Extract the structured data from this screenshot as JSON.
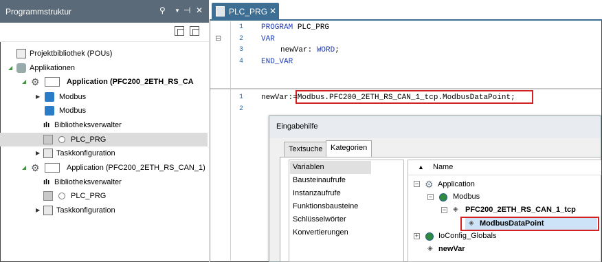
{
  "left_panel": {
    "title": "Programmstruktur",
    "header_icons": [
      "person-search-icon",
      "dropdown-icon",
      "pin-icon",
      "close-icon"
    ],
    "tree": [
      {
        "label": "Projektbibliothek (POUs)",
        "icon": "library-icon"
      },
      {
        "label": "Applikationen",
        "icon": "applications-icon"
      },
      {
        "label": "Application (PFC200_2ETH_RS_CA",
        "icon": "gear-icon",
        "bold": true
      },
      {
        "label": "Modbus",
        "icon": "folder-icon"
      },
      {
        "label": "Modbus",
        "icon": "folder-icon"
      },
      {
        "label": "Bibliotheksverwalter",
        "icon": "library-manager-icon"
      },
      {
        "label": "PLC_PRG",
        "icon": "program-icon",
        "selected": true
      },
      {
        "label": "Taskkonfiguration",
        "icon": "task-config-icon"
      },
      {
        "label": "Application (PFC200_2ETH_RS_CAN_1)",
        "icon": "gear-icon"
      },
      {
        "label": "Bibliotheksverwalter",
        "icon": "library-manager-icon"
      },
      {
        "label": "PLC_PRG",
        "icon": "program-icon"
      },
      {
        "label": "Taskkonfiguration",
        "icon": "task-config-icon"
      }
    ]
  },
  "editor": {
    "tab_label": "PLC_PRG",
    "tab_close": "✕",
    "declaration": {
      "line_numbers": [
        "1",
        "2",
        "3",
        "4"
      ],
      "lines": {
        "l1_kw": "PROGRAM",
        "l1_rest": " PLC_PRG",
        "l2_kw": "VAR",
        "l3_name": "newVar: ",
        "l3_type": "WORD",
        "l3_end": ";",
        "l4_kw": "END_VAR"
      },
      "collapse": "⊟"
    },
    "body": {
      "line_numbers": [
        "1",
        "2"
      ],
      "assign_left": "newVar:=",
      "assign_right": "Modbus.PFC200_2ETH_RS_CAN_1_tcp.ModbusDataPoint;"
    }
  },
  "dialog": {
    "title": "Eingabehilfe",
    "tabs": [
      "Textsuche",
      "Kategorien"
    ],
    "active_tab": "Kategorien",
    "categories": [
      "Variablen",
      "Bausteinaufrufe",
      "Instanzaufrufe",
      "Funktionsbausteine",
      "Schlüsselwörter",
      "Konvertierungen"
    ],
    "selected_category": "Variablen",
    "tree_header": "Name",
    "tree": [
      {
        "label": "Application",
        "icon": "gear-icon"
      },
      {
        "label": "Modbus",
        "icon": "globe-icon"
      },
      {
        "label": "PFC200_2ETH_RS_CAN_1_tcp",
        "icon": "struct-icon"
      },
      {
        "label": "ModbusDataPoint",
        "icon": "struct-icon"
      },
      {
        "label": "IoConfig_Globals",
        "icon": "globe-icon"
      },
      {
        "label": "newVar",
        "icon": "variable-icon"
      }
    ]
  },
  "colors": {
    "panel_header": "#5b6a78",
    "tab_active": "#3d6f94",
    "keyword": "#1f3bb4",
    "highlight_box": "#d42020"
  }
}
